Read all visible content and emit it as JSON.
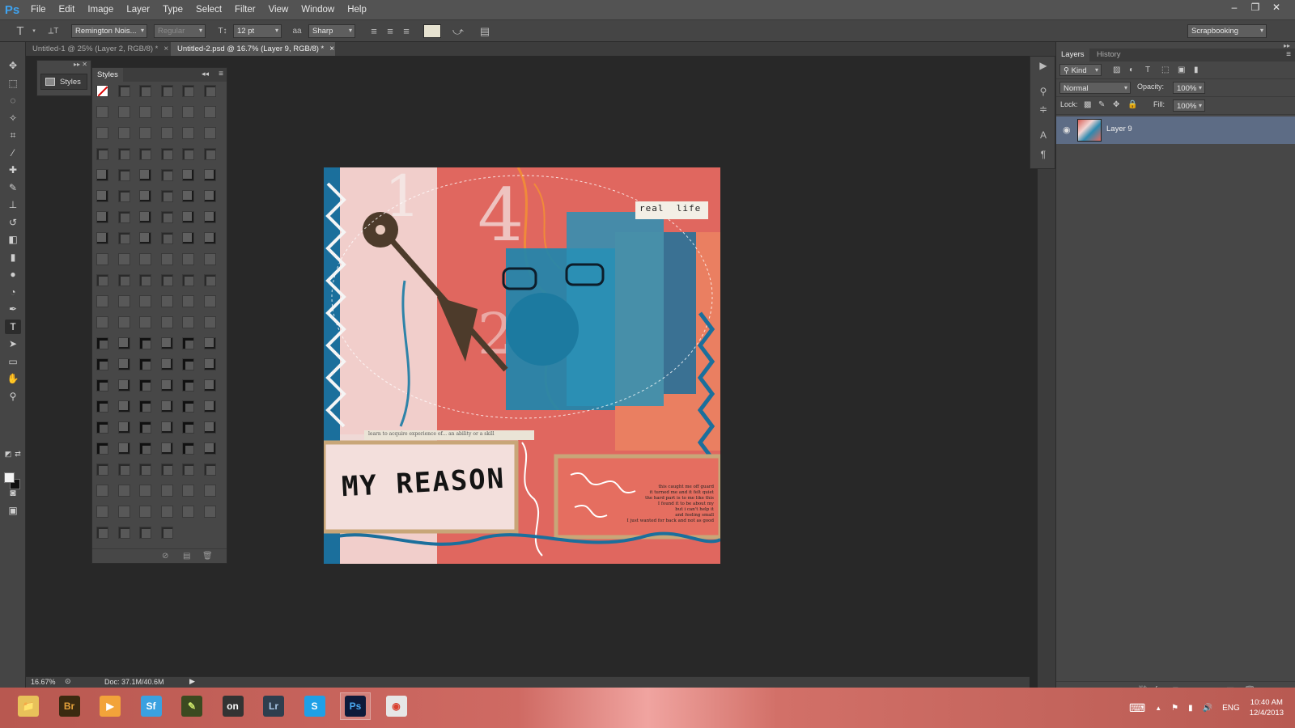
{
  "app": {
    "logo": "Ps"
  },
  "menu": [
    "File",
    "Edit",
    "Image",
    "Layer",
    "Type",
    "Select",
    "Filter",
    "View",
    "Window",
    "Help"
  ],
  "window_controls": {
    "minimize": "–",
    "restore": "❐",
    "close": "✕"
  },
  "options_bar": {
    "tool_icon": "T",
    "orientation_icon": "⟂T",
    "font_family": "Remington Nois...",
    "font_style": "Regular",
    "font_size_icon": "T↕",
    "font_size": "12 pt",
    "antialias_icon": "aa",
    "antialias": "Sharp",
    "align_left": "≡",
    "align_center": "≡",
    "align_right": "≡",
    "text_color": "#e6e2d0",
    "warp_icon": "⤻",
    "panels_icon": "▤",
    "workspace": "Scrapbooking"
  },
  "tabs": [
    {
      "label": "Untitled-1 @ 25% (Layer 2, RGB/8) *",
      "active": false
    },
    {
      "label": "Untitled-2.psd @ 16.7% (Layer 9, RGB/8) *",
      "active": true
    }
  ],
  "tools": [
    {
      "name": "move",
      "glyph": "✥"
    },
    {
      "name": "marquee",
      "glyph": "⬚"
    },
    {
      "name": "lasso",
      "glyph": "◌"
    },
    {
      "name": "magic-wand",
      "glyph": "✧"
    },
    {
      "name": "crop",
      "glyph": "⌗"
    },
    {
      "name": "eyedropper",
      "glyph": "⁄"
    },
    {
      "name": "healing",
      "glyph": "✚"
    },
    {
      "name": "brush",
      "glyph": "✎"
    },
    {
      "name": "stamp",
      "glyph": "⊥"
    },
    {
      "name": "history-brush",
      "glyph": "↺"
    },
    {
      "name": "eraser",
      "glyph": "◧"
    },
    {
      "name": "gradient",
      "glyph": "▮"
    },
    {
      "name": "blur",
      "glyph": "●"
    },
    {
      "name": "dodge",
      "glyph": "◔"
    },
    {
      "name": "pen",
      "glyph": "✒"
    },
    {
      "name": "type",
      "glyph": "T",
      "active": true
    },
    {
      "name": "path-select",
      "glyph": "➤"
    },
    {
      "name": "shape",
      "glyph": "▭"
    },
    {
      "name": "hand",
      "glyph": "✋"
    },
    {
      "name": "zoom",
      "glyph": "⚲"
    }
  ],
  "collapsed_panel": {
    "label": "Styles"
  },
  "styles_panel": {
    "tab": "Styles",
    "menu_icon": "≡",
    "collapse_icon": "◂◂"
  },
  "document": {
    "stamp_words": [
      "real",
      "life"
    ],
    "title": "MY REASON",
    "strip_text": "learn to acquire experience of... an ability or a skill",
    "journal_lines": [
      "this caught me off guard",
      "it turned me and it felt quiet",
      "the hard part is to me like this",
      "I found it to be about my",
      "but i can't help it",
      "and feeling small",
      "I just wanted for back and not as good"
    ]
  },
  "layers_panel": {
    "tabs": [
      "Layers",
      "History"
    ],
    "kind_label": "Kind",
    "blend_mode": "Normal",
    "opacity_label": "Opacity:",
    "opacity": "100%",
    "lock_label": "Lock:",
    "fill_label": "Fill:",
    "fill": "100%",
    "layers": [
      {
        "name": "Layer 9",
        "visible": true,
        "selected": true
      }
    ]
  },
  "status": {
    "zoom": "16.67%",
    "doc": "Doc: 37.1M/40.6M"
  },
  "taskbar": {
    "apps": [
      {
        "name": "file-explorer",
        "label": "📁",
        "color": "#e8c15a",
        "fg": "#333",
        "running": false
      },
      {
        "name": "bridge",
        "label": "Br",
        "color": "#3b2a10",
        "fg": "#e5a13a",
        "running": false
      },
      {
        "name": "media",
        "label": "▶",
        "color": "#f2a33a",
        "fg": "#fff",
        "running": false
      },
      {
        "name": "sf",
        "label": "Sf",
        "color": "#3aa1e0",
        "fg": "#fff",
        "running": false
      },
      {
        "name": "pen-app",
        "label": "✎",
        "color": "#3b4a20",
        "fg": "#cde86b",
        "running": false
      },
      {
        "name": "on1",
        "label": "on",
        "color": "#333",
        "fg": "#fff",
        "running": false
      },
      {
        "name": "lightroom",
        "label": "Lr",
        "color": "#2e3e4e",
        "fg": "#a9c7e6",
        "running": false
      },
      {
        "name": "skype",
        "label": "S",
        "color": "#1fa0e6",
        "fg": "#fff",
        "running": false
      },
      {
        "name": "photoshop",
        "label": "Ps",
        "color": "#0d1a3a",
        "fg": "#4aa8f0",
        "running": true
      },
      {
        "name": "chrome",
        "label": "◉",
        "color": "#e6e6e6",
        "fg": "#d9402e",
        "running": false
      }
    ],
    "tray": {
      "keyboard": "⌨",
      "up_arrow": "▲",
      "flag": "⚑",
      "signal": "▮",
      "volume": "🔊",
      "language": "ENG",
      "time": "10:40 AM",
      "date": "12/4/2013"
    }
  }
}
